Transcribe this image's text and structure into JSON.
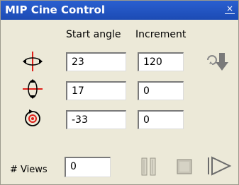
{
  "window": {
    "title": "MIP Cine Control",
    "close_glyph": "×"
  },
  "columns": {
    "start_angle": "Start angle",
    "increment": "Increment"
  },
  "rows": [
    {
      "icon": "rotate-horizontal-icon",
      "start": "23",
      "increment": "120"
    },
    {
      "icon": "rotate-vertical-icon",
      "start": "17",
      "increment": "0"
    },
    {
      "icon": "rotate-inplane-icon",
      "start": "-33",
      "increment": "0"
    }
  ],
  "views": {
    "label": "# Views",
    "value": "0"
  },
  "icons": {
    "apply": "apply-rotation-icon",
    "pause": "pause-icon",
    "stop": "stop-icon",
    "play": "play-icon"
  },
  "colors": {
    "accent_red": "#e0201a",
    "title_bar": "#1c4bb4"
  }
}
